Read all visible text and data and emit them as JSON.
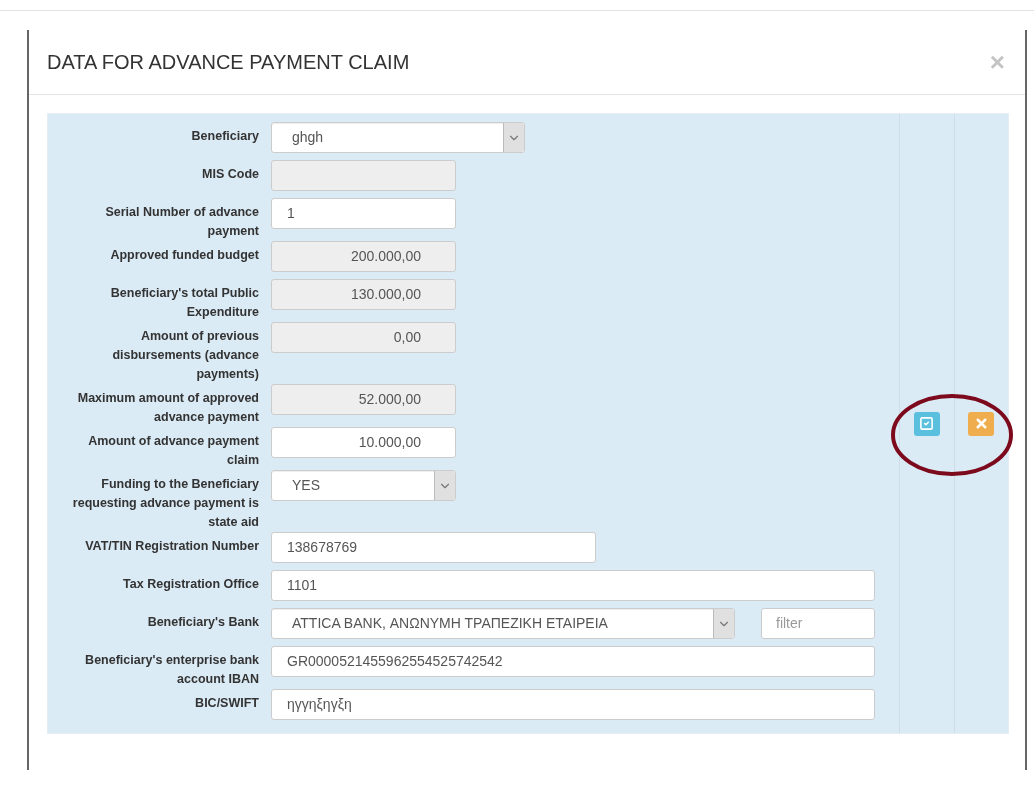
{
  "dialog": {
    "title": "DATA FOR ADVANCE PAYMENT CLAIM",
    "close": "×"
  },
  "fields": [
    {
      "label": "Beneficiary",
      "kind": "select",
      "value": "ghgh"
    },
    {
      "label": "MIS Code",
      "kind": "readonly"
    },
    {
      "label": "Serial Number of advance payment",
      "kind": "text",
      "value": "1"
    },
    {
      "label": "Approved funded budget",
      "kind": "readonly",
      "value": "200.000,00"
    },
    {
      "label": "Beneficiary's total Public Expenditure",
      "kind": "readonly",
      "value": "130.000,00"
    },
    {
      "label": "Amount of previous disbursements (advance payments)",
      "kind": "readonly",
      "value": "0,00"
    },
    {
      "label": "Maximum amount of approved advance payment",
      "kind": "readonly",
      "value": "52.000,00"
    },
    {
      "label": "Amount of advance payment claim",
      "kind": "amount",
      "value": "10.000,00"
    },
    {
      "label": "Funding to the Beneficiary requesting advance payment is state aid",
      "kind": "select",
      "value": "YES"
    },
    {
      "label": "VAT/TIN Registration Number",
      "kind": "text",
      "value": "138678769"
    },
    {
      "label": "Tax Registration Office",
      "kind": "text",
      "value": "1101"
    },
    {
      "label": "Beneficiary's Bank",
      "kind": "select",
      "value": "ATTICA BANK, ΑΝΩΝΥΜΗ ΤΡΑΠΕΖΙΚΗ ΕΤΑΙΡΕΙΑ",
      "filter": {
        "placeholder": "filter"
      }
    },
    {
      "label": "Beneficiary's enterprise bank account IBAN",
      "kind": "text",
      "value": "GR0000521455962554525742542"
    },
    {
      "label": "BIC/SWIFT",
      "kind": "text",
      "value": "ηγγηξηγξη"
    }
  ],
  "actions": [
    {
      "kind": "edit"
    },
    {
      "kind": "cancel"
    }
  ]
}
